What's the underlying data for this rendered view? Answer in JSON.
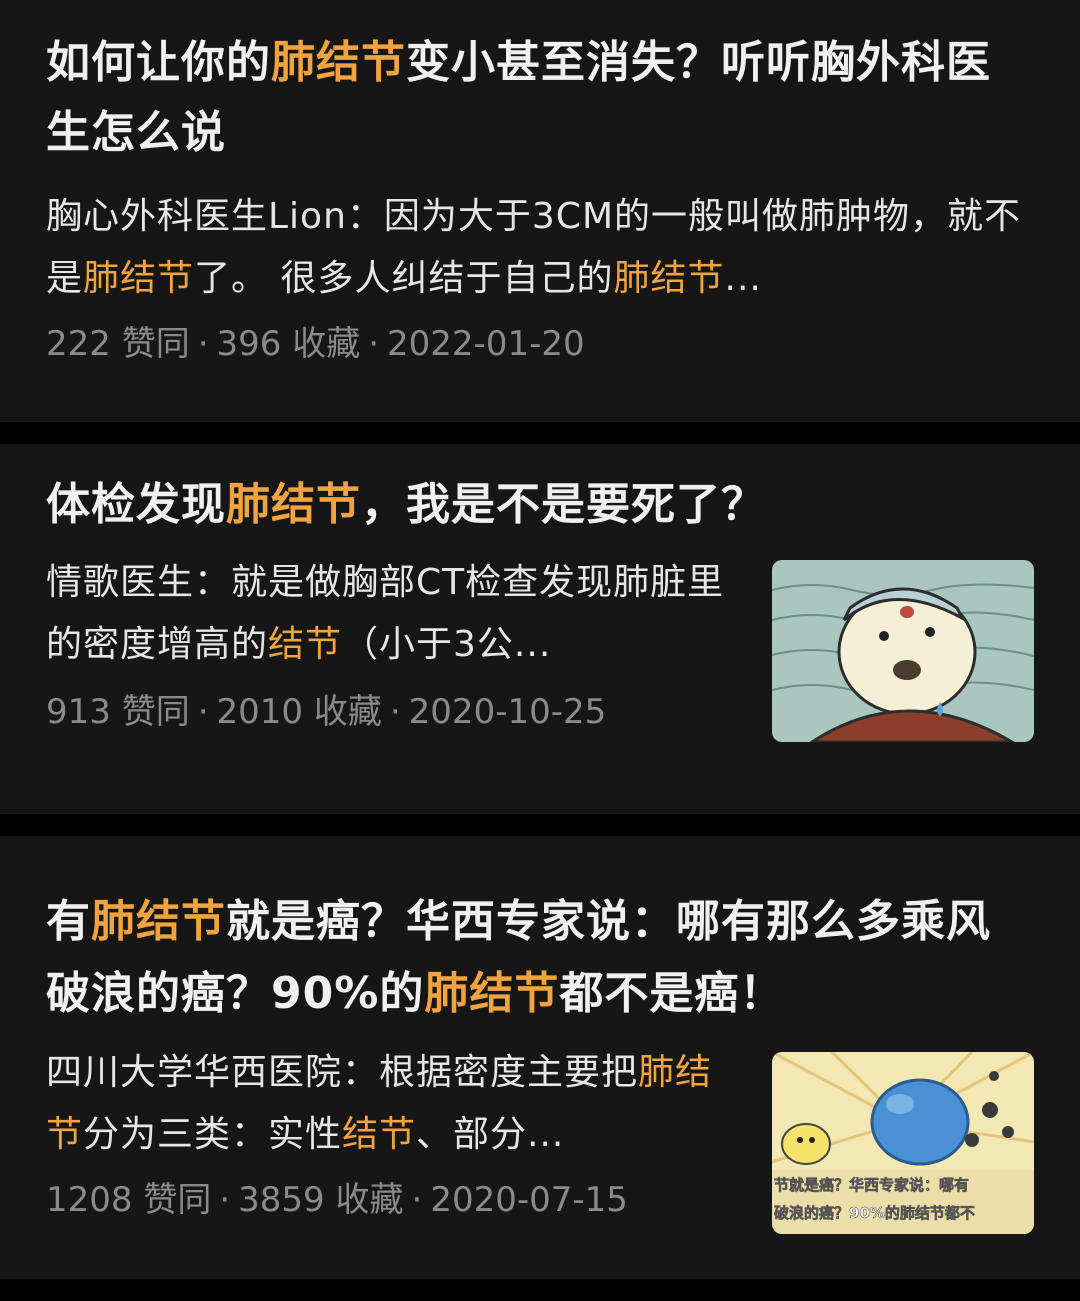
{
  "colors": {
    "background": "#000000",
    "card": "#161616",
    "highlight": "#f0a33e",
    "title": "#f0f0f0",
    "meta": "#8a8a8a"
  },
  "items": [
    {
      "title": [
        {
          "text": "如何让你的",
          "hl": false
        },
        {
          "text": "肺结节",
          "hl": true
        },
        {
          "text": "变小甚至消失？听听胸外科医生怎么说",
          "hl": false
        }
      ],
      "excerpt": [
        {
          "text": "胸心外科医生Lion：因为大于3CM的一般叫做肺肿物，就不是",
          "hl": false
        },
        {
          "text": "肺结节",
          "hl": true
        },
        {
          "text": "了。 很多人纠结于自己的",
          "hl": false
        },
        {
          "text": "肺结节",
          "hl": true
        },
        {
          "text": "...",
          "hl": false
        }
      ],
      "likes": "222 赞同",
      "favorites": "396 收藏",
      "date": "2022-01-20",
      "separator": "·"
    },
    {
      "title": [
        {
          "text": "体检发现",
          "hl": false
        },
        {
          "text": "肺结节",
          "hl": true
        },
        {
          "text": "，我是不是要死了？",
          "hl": false
        }
      ],
      "excerpt": [
        {
          "text": "情歌医生：就是做胸部CT检查发现肺脏里的密度增高的",
          "hl": false
        },
        {
          "text": "结节",
          "hl": true
        },
        {
          "text": "（小于3公...",
          "hl": false
        }
      ],
      "likes": "913 赞同",
      "favorites": "2010 收藏",
      "date": "2020-10-25",
      "separator": "·",
      "thumbnail": "cartoon-character-under-water"
    },
    {
      "title": [
        {
          "text": "有",
          "hl": false
        },
        {
          "text": "肺结节",
          "hl": true
        },
        {
          "text": "就是癌？华西专家说：哪有那么多乘风破浪的癌？90%的",
          "hl": false
        },
        {
          "text": "肺结节",
          "hl": true
        },
        {
          "text": "都不是癌！",
          "hl": false
        }
      ],
      "excerpt": [
        {
          "text": "四川大学华西医院：根据密度主要把",
          "hl": false
        },
        {
          "text": "肺结节",
          "hl": true
        },
        {
          "text": "分为三类：实性",
          "hl": false
        },
        {
          "text": "结节",
          "hl": true
        },
        {
          "text": "、部分...",
          "hl": false
        }
      ],
      "likes": "1208 赞同",
      "favorites": "3859 收藏",
      "date": "2020-07-15",
      "separator": "·",
      "thumbnail": "cartoon-lung-nodule-illustration",
      "thumbnail_text": [
        "节就是癌？华西专家说：哪有",
        "破浪的癌？90%的肺结节都不"
      ]
    }
  ]
}
